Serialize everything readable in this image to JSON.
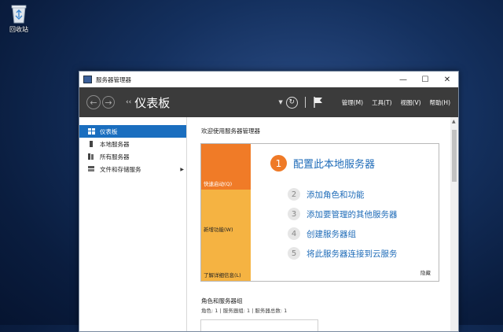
{
  "desktop": {
    "recycle_bin_label": "回收站"
  },
  "window": {
    "title": "服务器管理器",
    "controls": {
      "minimize": "—",
      "maximize": "☐",
      "close": "✕"
    }
  },
  "toolbar": {
    "breadcrumb_prefix": "‹‹",
    "breadcrumb": "仪表板",
    "menus": [
      "管理(M)",
      "工具(T)",
      "视图(V)",
      "帮助(H)"
    ]
  },
  "sidebar": {
    "items": [
      {
        "label": "仪表板",
        "icon": "dashboard-icon",
        "active": true
      },
      {
        "label": "本地服务器",
        "icon": "server-icon"
      },
      {
        "label": "所有服务器",
        "icon": "servers-icon"
      },
      {
        "label": "文件和存储服务",
        "icon": "storage-icon",
        "has_arrow": true
      }
    ]
  },
  "main": {
    "welcome": "欢迎使用服务器管理器",
    "tiles": [
      "快速启动(Q)",
      "新增功能(W)",
      "了解详细信息(L)"
    ],
    "main_step": {
      "num": "1",
      "text": "配置此本地服务器"
    },
    "steps": [
      {
        "num": "2",
        "text": "添加角色和功能"
      },
      {
        "num": "3",
        "text": "添加要管理的其他服务器"
      },
      {
        "num": "4",
        "text": "创建服务器组"
      },
      {
        "num": "5",
        "text": "将此服务器连接到云服务"
      }
    ],
    "hide_label": "隐藏",
    "roles_title": "角色和服务器组",
    "roles_sub": "角色: 1 | 服务器组: 1 | 服务器总数: 1"
  },
  "colors": {
    "accent": "#1a6ebf",
    "tile_orange": "#f07b27",
    "tile_yellow": "#f5b342",
    "toolbar": "#3b3b3b"
  }
}
